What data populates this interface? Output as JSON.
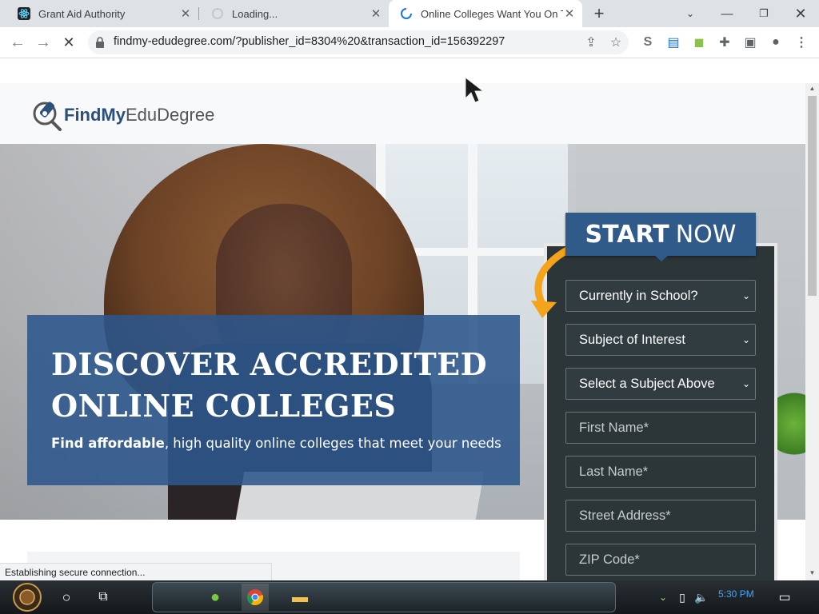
{
  "browser": {
    "tabs": [
      {
        "title": "Grant Aid Authority",
        "active": false
      },
      {
        "title": "Loading...",
        "active": false
      },
      {
        "title": "Online Colleges Want You On T",
        "active": true
      }
    ],
    "url": "findmy-edudegree.com/?publisher_id=8304%20&transaction_id=156392297",
    "status_text": "Establishing secure connection..."
  },
  "site": {
    "logo_bold": "FindMy",
    "logo_light": "EduDegree",
    "headline_line1": "DISCOVER ACCREDITED",
    "headline_line2": "ONLINE COLLEGES",
    "subline_bold": "Find affordable",
    "subline_rest": ", high quality online colleges that meet your needs"
  },
  "form": {
    "banner_bold": "START",
    "banner_light": "NOW",
    "selects": [
      {
        "label": "Currently in School?"
      },
      {
        "label": "Subject of Interest"
      },
      {
        "label": "Select a Subject Above"
      }
    ],
    "inputs": [
      {
        "placeholder": "First Name*"
      },
      {
        "placeholder": "Last Name*"
      },
      {
        "placeholder": "Street Address*"
      },
      {
        "placeholder": "ZIP Code*"
      }
    ]
  },
  "taskbar": {
    "clock": "5:30 PM"
  },
  "colors": {
    "brand_blue": "#2c4f7c",
    "form_bg": "#2c3538",
    "arrow_orange": "#f5a31a"
  }
}
